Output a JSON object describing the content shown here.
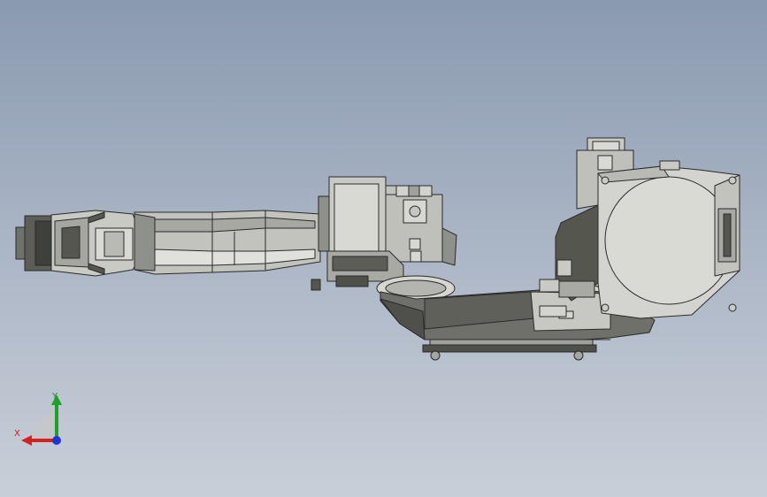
{
  "viewport": {
    "background_top": "#8a9ab0",
    "background_bottom": "#c9cfd8"
  },
  "model": {
    "body_color": "#d3d4cf",
    "shadow_color": "#55574f",
    "edge_color": "#2a2a28"
  },
  "triad": {
    "x_label": "X",
    "y_label": "Y",
    "x_color": "#d42020",
    "y_color": "#1fa02a",
    "z_color": "#1f36d4"
  }
}
